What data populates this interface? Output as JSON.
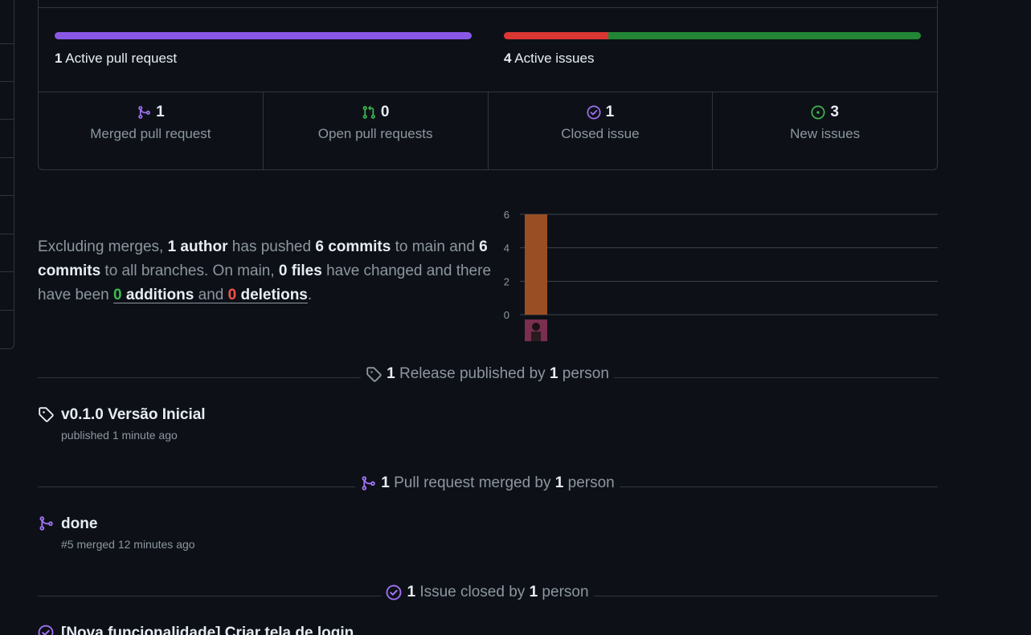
{
  "summary": {
    "pr_bar": {
      "count": "1",
      "label": " Active pull request",
      "color": "#8957e5"
    },
    "issues_bar": {
      "count": "4",
      "label": " Active issues",
      "closed_fraction": 0.25,
      "closed_color": "#da3633",
      "open_color": "#238636"
    },
    "stats": [
      {
        "value": "1",
        "label": "Merged pull request",
        "icon": "git-merge-icon",
        "color": "#a371f7"
      },
      {
        "value": "0",
        "label": "Open pull requests",
        "icon": "git-pull-request-icon",
        "color": "#3fb950"
      },
      {
        "value": "1",
        "label": "Closed issue",
        "icon": "issue-closed-icon",
        "color": "#a371f7"
      },
      {
        "value": "3",
        "label": "New issues",
        "icon": "issue-opened-icon",
        "color": "#3fb950"
      }
    ]
  },
  "commit_summary": {
    "p1": "Excluding merges, ",
    "authors": "1 author",
    "p2": " has pushed ",
    "commits_main": "6 commits",
    "p3": " to main and ",
    "commits_all": "6 commits",
    "p4": " to all branches. On main, ",
    "files": "0 files",
    "p5": " have changed and there have been ",
    "additions_num": "0",
    "additions_word": " additions",
    "and": " and ",
    "deletions_num": "0",
    "deletions_word": " deletions",
    "end": "."
  },
  "chart_data": {
    "type": "bar",
    "categories": [
      "author"
    ],
    "values": [
      6
    ],
    "ylim": [
      0,
      6
    ],
    "yticks": [
      "0",
      "2",
      "4",
      "6"
    ],
    "bar_color": "#9a4e23",
    "grid": true
  },
  "releases": {
    "header": {
      "count": "1",
      "text1": " Release published by ",
      "count2": "1",
      "text2": " person"
    },
    "items": [
      {
        "title": "v0.1.0 Versão Inicial",
        "subtitle": "published 1 minute ago"
      }
    ]
  },
  "pull_requests": {
    "header": {
      "count": "1",
      "text1": " Pull request merged by ",
      "count2": "1",
      "text2": " person"
    },
    "items": [
      {
        "title": "done",
        "subtitle": "#5 merged 12 minutes ago"
      }
    ]
  },
  "issues": {
    "header": {
      "count": "1",
      "text1": " Issue closed by ",
      "count2": "1",
      "text2": " person"
    },
    "items": [
      {
        "title": "[Nova funcionalidade] Criar tela de login"
      }
    ]
  }
}
